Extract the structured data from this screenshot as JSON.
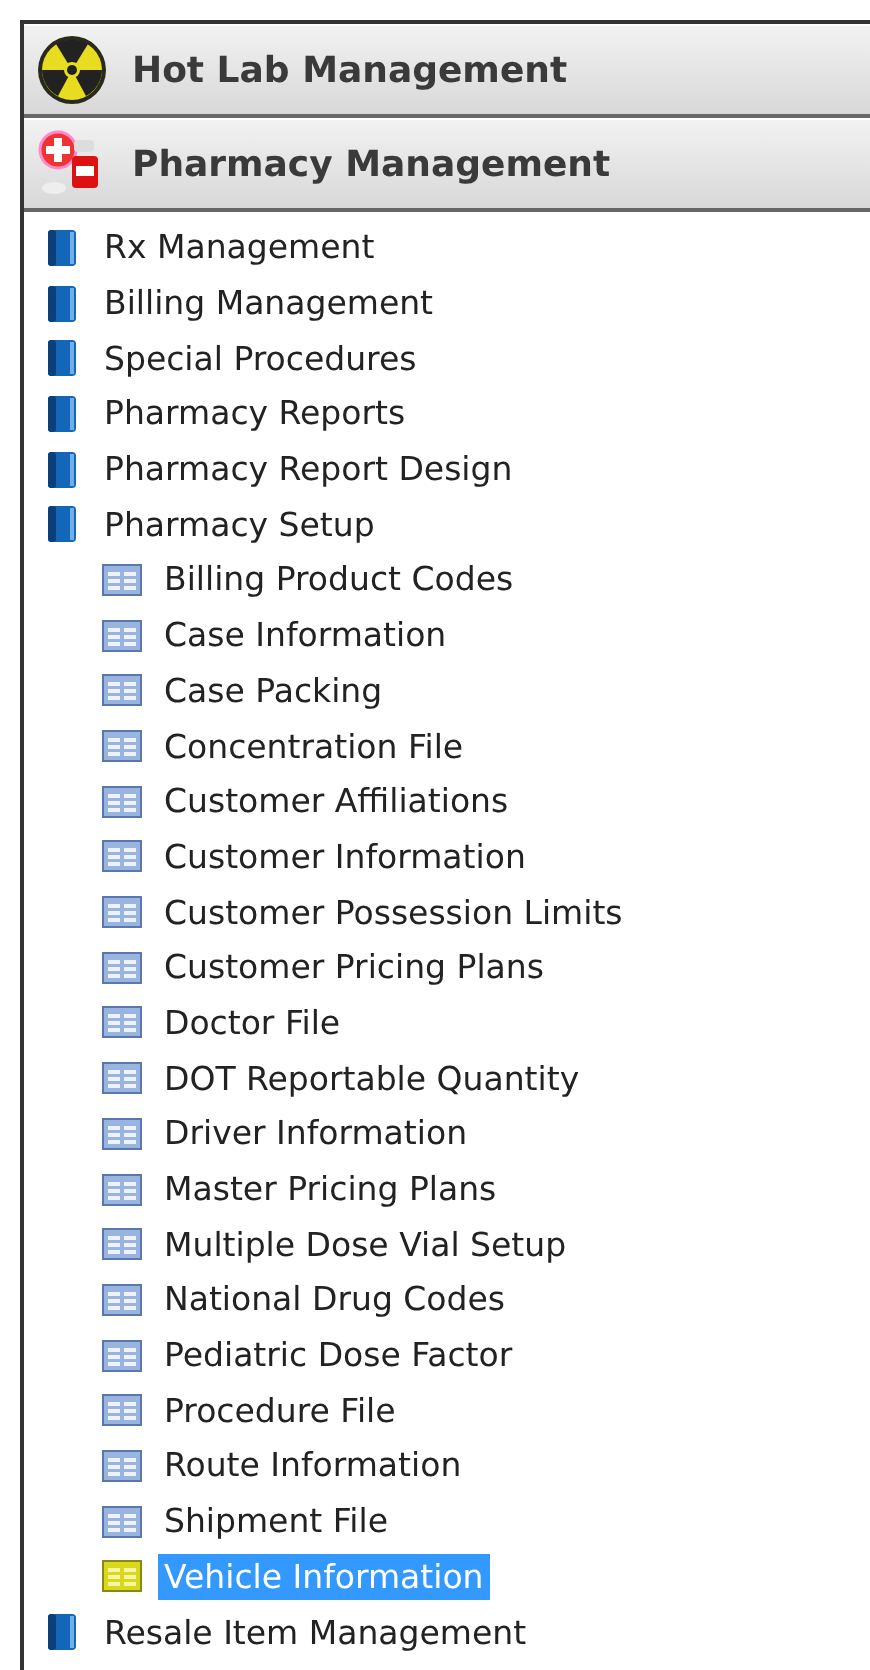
{
  "headers": [
    {
      "label": "Hot Lab Management",
      "kind": "radiation"
    },
    {
      "label": "Pharmacy Management",
      "kind": "pharmacy"
    }
  ],
  "tree": [
    {
      "label": "Rx Management",
      "selected": false
    },
    {
      "label": "Billing Management",
      "selected": false
    },
    {
      "label": "Special Procedures",
      "selected": false
    },
    {
      "label": "Pharmacy Reports",
      "selected": false
    },
    {
      "label": "Pharmacy Report Design",
      "selected": false
    },
    {
      "label": "Pharmacy Setup",
      "selected": false,
      "children": [
        {
          "label": "Billing Product Codes",
          "selected": false
        },
        {
          "label": "Case Information",
          "selected": false
        },
        {
          "label": "Case Packing",
          "selected": false
        },
        {
          "label": "Concentration File",
          "selected": false
        },
        {
          "label": "Customer Affiliations",
          "selected": false
        },
        {
          "label": "Customer Information",
          "selected": false
        },
        {
          "label": "Customer Possession Limits",
          "selected": false
        },
        {
          "label": "Customer Pricing Plans",
          "selected": false
        },
        {
          "label": "Doctor File",
          "selected": false
        },
        {
          "label": "DOT Reportable Quantity",
          "selected": false
        },
        {
          "label": "Driver Information",
          "selected": false
        },
        {
          "label": "Master Pricing Plans",
          "selected": false
        },
        {
          "label": "Multiple Dose Vial Setup",
          "selected": false
        },
        {
          "label": "National Drug Codes",
          "selected": false
        },
        {
          "label": "Pediatric Dose Factor",
          "selected": false
        },
        {
          "label": "Procedure File",
          "selected": false
        },
        {
          "label": "Route Information",
          "selected": false
        },
        {
          "label": "Shipment File",
          "selected": false
        },
        {
          "label": "Vehicle Information",
          "selected": true
        }
      ]
    },
    {
      "label": "Resale Item Management",
      "selected": false
    }
  ]
}
